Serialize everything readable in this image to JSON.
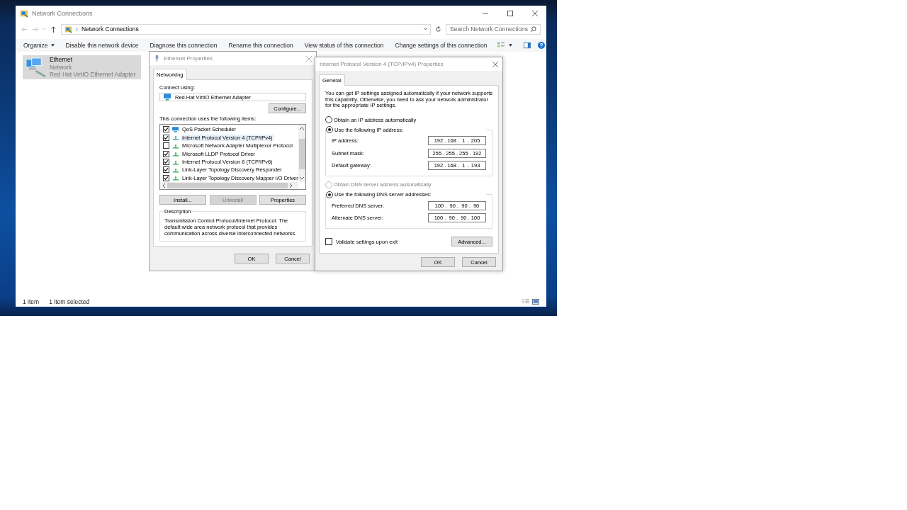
{
  "explorer": {
    "title": "Network Connections",
    "breadcrumb": "Network Connections",
    "search": {
      "placeholder": "Search Network Connections"
    },
    "toolbar": [
      {
        "label": "Organize",
        "kind": "menu"
      },
      {
        "label": "Disable this network device",
        "kind": "command"
      },
      {
        "label": "Diagnose this connection",
        "kind": "command"
      },
      {
        "label": "Rename this connection",
        "kind": "command"
      },
      {
        "label": "View status of this connection",
        "kind": "command"
      },
      {
        "label": "Change settings of this connection",
        "kind": "command"
      }
    ],
    "items": [
      {
        "name": "Ethernet",
        "status": "Network",
        "device": "Red Hat VirtIO Ethernet Adapter",
        "selected": true
      }
    ],
    "status_bar": [
      "1 item",
      "1 item selected"
    ]
  },
  "ethernet_dialog": {
    "title": "Ethernet Properties",
    "tabs": [
      {
        "label": "Networking",
        "selected": true
      }
    ],
    "connect_label": "Connect using:",
    "adapter": "Red Hat VirtIO Ethernet Adapter",
    "configure_button": "Configure...",
    "items_label": "This connection uses the following items:",
    "components": [
      {
        "label": "QoS Packet Scheduler",
        "kind": "service",
        "checked": true,
        "selected": false
      },
      {
        "label": "Internet Protocol Version 4 (TCP/IPv4)",
        "kind": "protocol",
        "checked": true,
        "selected": true
      },
      {
        "label": "Microsoft Network Adapter Multiplexor Protocol",
        "kind": "protocol",
        "checked": false,
        "selected": false
      },
      {
        "label": "Microsoft LLDP Protocol Driver",
        "kind": "protocol",
        "checked": true,
        "selected": false
      },
      {
        "label": "Internet Protocol Version 6 (TCP/IPv6)",
        "kind": "protocol",
        "checked": true,
        "selected": false
      },
      {
        "label": "Link-Layer Topology Discovery Responder",
        "kind": "protocol",
        "checked": true,
        "selected": false
      },
      {
        "label": "Link-Layer Topology Discovery Mapper I/O Driver",
        "kind": "protocol",
        "checked": true,
        "selected": false
      }
    ],
    "buttons": [
      {
        "label": "Install...",
        "disabled": false
      },
      {
        "label": "Uninstall",
        "disabled": true
      },
      {
        "label": "Properties",
        "disabled": false
      }
    ],
    "description_title": "Description",
    "description": "Transmission Control Protocol/Internet Protocol. The default wide area network protocol that provides communication across diverse interconnected networks.",
    "dialog_buttons": [
      "OK",
      "Cancel"
    ]
  },
  "ipv4_dialog": {
    "title": "Internet Protocol Version 4 (TCP/IPv4) Properties",
    "tabs": [
      {
        "label": "General",
        "selected": true
      }
    ],
    "intro": "You can get IP settings assigned automatically if your network supports this capability. Otherwise, you need to ask your network administrator for the appropriate IP settings.",
    "ip_options": [
      {
        "label": "Obtain an IP address automatically",
        "selected": false,
        "disabled": false
      },
      {
        "label": "Use the following IP address:",
        "selected": true,
        "disabled": false
      }
    ],
    "ip_fields": [
      {
        "label": "IP address:",
        "value": "192 . 168 .  1  . 205"
      },
      {
        "label": "Subnet mask:",
        "value": "255 . 255 . 255 . 192"
      },
      {
        "label": "Default gateway:",
        "value": "192 . 168 .  1  . 193"
      }
    ],
    "dns_options": [
      {
        "label": "Obtain DNS server address automatically",
        "selected": false,
        "disabled": true
      },
      {
        "label": "Use the following DNS server addresses:",
        "selected": true,
        "disabled": false
      }
    ],
    "dns_fields": [
      {
        "label": "Preferred DNS server:",
        "value": "100 .  90 .  90 .  90"
      },
      {
        "label": "Alternate DNS server:",
        "value": "100 .  90 .  90 . 100"
      }
    ],
    "validate": {
      "label": "Validate settings upon exit",
      "checked": false
    },
    "advanced_button": "Advanced...",
    "dialog_buttons": [
      "OK",
      "Cancel"
    ]
  }
}
